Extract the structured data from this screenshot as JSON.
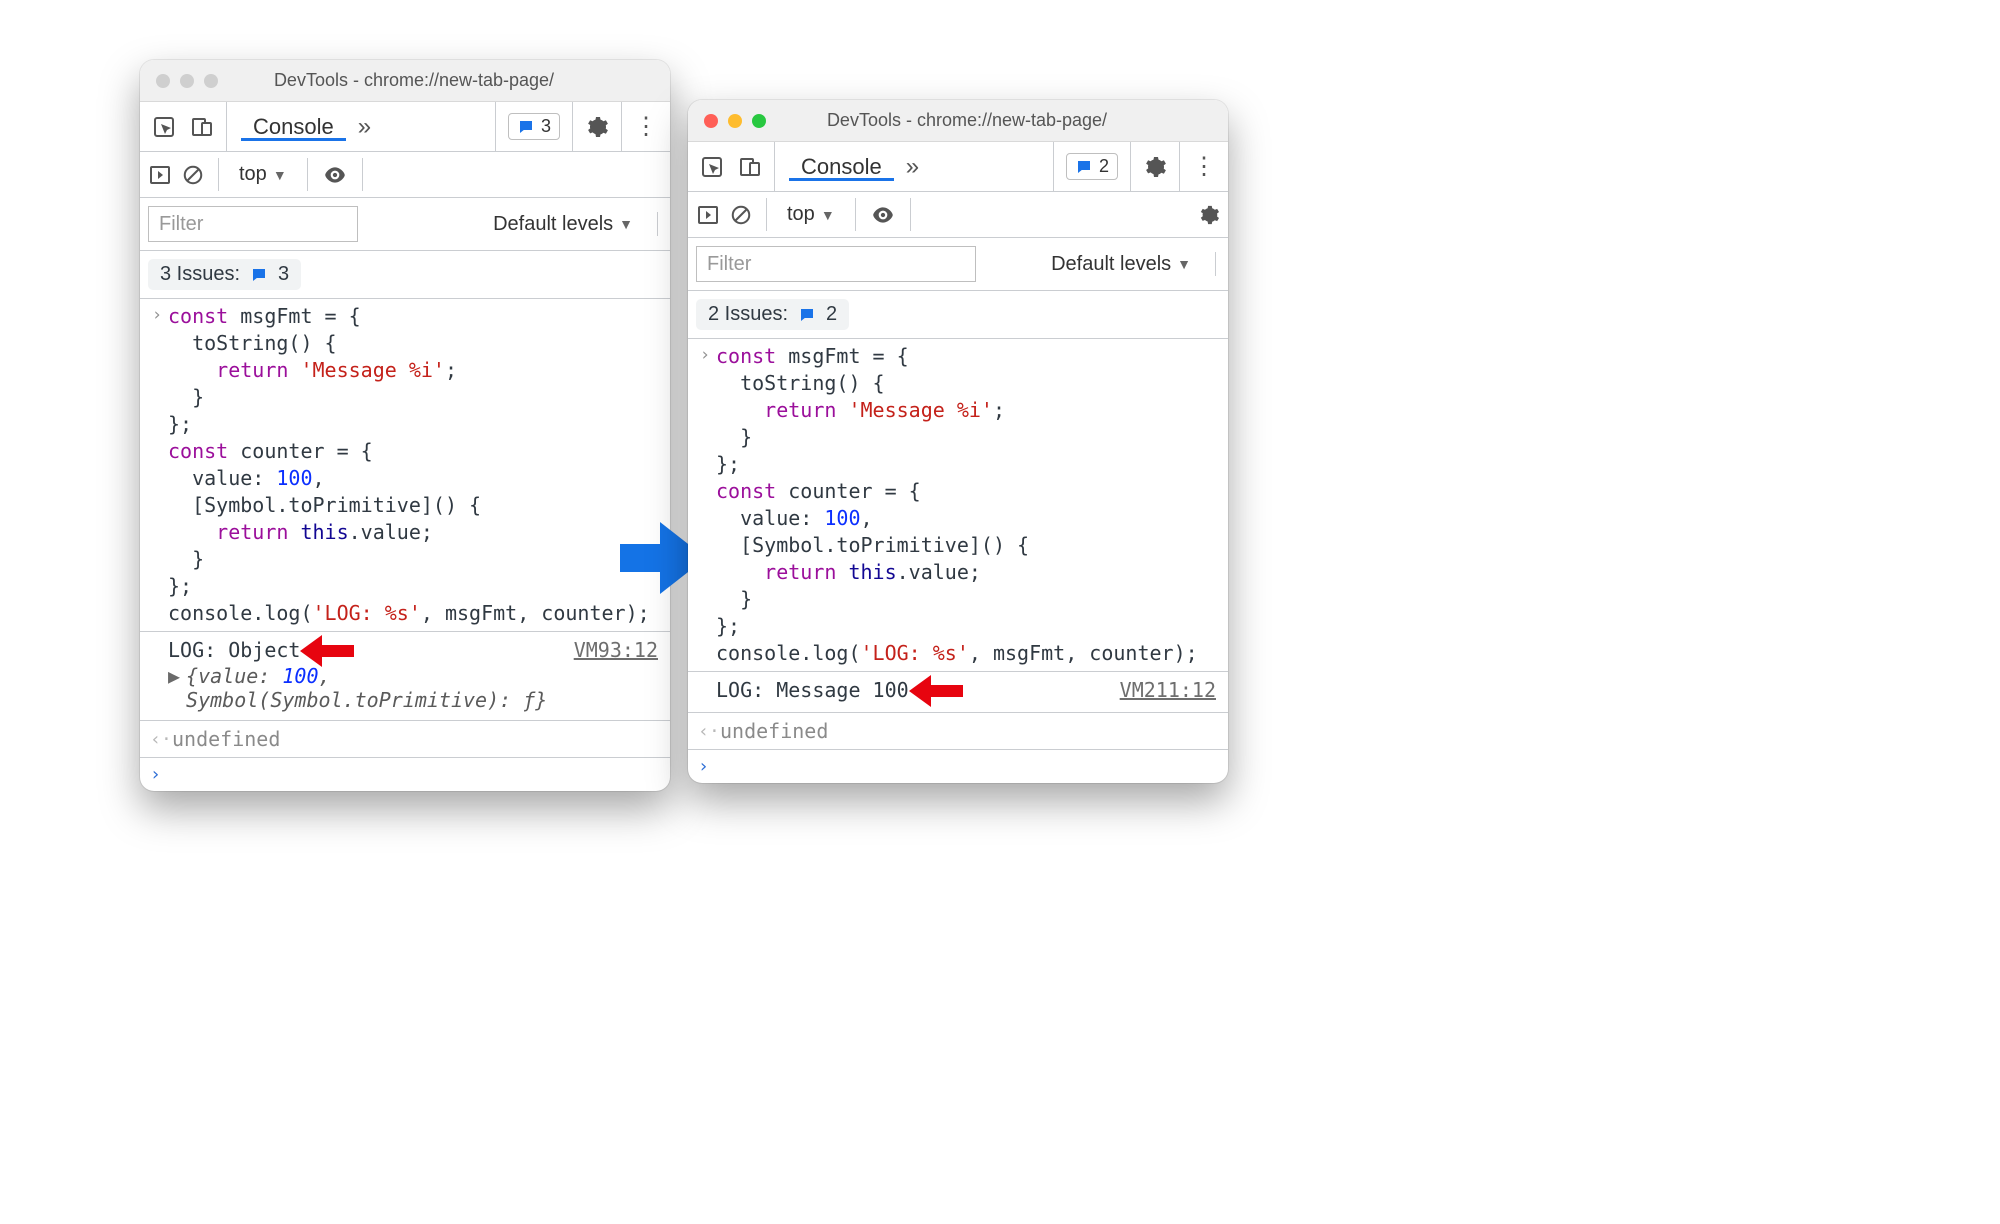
{
  "left": {
    "title": "DevTools - chrome://new-tab-page/",
    "inactiveDots": true,
    "tab": "Console",
    "pillCount": "3",
    "context": "top",
    "filterPlaceholder": "Filter",
    "levelsLabel": "Default levels",
    "issuesLabel": "3 Issues:",
    "issuesCount": "3",
    "code": {
      "l1a": "const",
      "l1b": " msgFmt = {",
      "l2": "  toString() {",
      "l3a": "    ",
      "l3b": "return",
      "l3c": " ",
      "l3d": "'Message %i'",
      "l3e": ";",
      "l4": "  }",
      "l5": "};",
      "l6a": "const",
      "l6b": " counter = {",
      "l7a": "  value: ",
      "l7b": "100",
      "l7c": ",",
      "l8": "  [Symbol.toPrimitive]() {",
      "l9a": "    ",
      "l9b": "return",
      "l9c": " ",
      "l9d": "this",
      "l9e": ".value;",
      "l10": "  }",
      "l11": "};",
      "l12a": "console.log(",
      "l12b": "'LOG: %s'",
      "l12c": ", msgFmt, counter);"
    },
    "logText": "LOG: Object",
    "source": "VM93:12",
    "expand": {
      "pre": "{value: ",
      "val": "100",
      "post": ", Symbol(Symbol.toPrimitive): ƒ}"
    },
    "undefined": "undefined"
  },
  "right": {
    "title": "DevTools - chrome://new-tab-page/",
    "inactiveDots": false,
    "tab": "Console",
    "pillCount": "2",
    "context": "top",
    "filterPlaceholder": "Filter",
    "levelsLabel": "Default levels",
    "issuesLabel": "2 Issues:",
    "issuesCount": "2",
    "logText": "LOG: Message 100",
    "source": "VM211:12",
    "undefined": "undefined"
  }
}
